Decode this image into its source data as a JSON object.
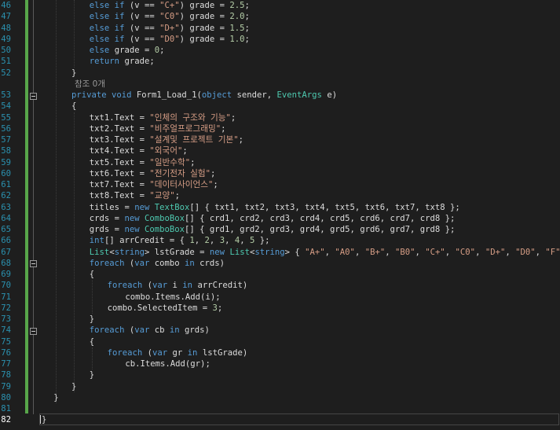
{
  "editor": {
    "code_lens": "참조 0개",
    "lines": [
      {
        "num": "46",
        "indent": 8,
        "tokens": [
          {
            "c": "kw",
            "t": "else if"
          },
          {
            "c": "pl",
            "t": " (v == "
          },
          {
            "c": "st",
            "t": "\"C+\""
          },
          {
            "c": "pl",
            "t": ") grade = "
          },
          {
            "c": "nu",
            "t": "2.5"
          },
          {
            "c": "pl",
            "t": ";"
          }
        ]
      },
      {
        "num": "47",
        "indent": 8,
        "tokens": [
          {
            "c": "kw",
            "t": "else if"
          },
          {
            "c": "pl",
            "t": " (v == "
          },
          {
            "c": "st",
            "t": "\"C0\""
          },
          {
            "c": "pl",
            "t": ") grade = "
          },
          {
            "c": "nu",
            "t": "2.0"
          },
          {
            "c": "pl",
            "t": ";"
          }
        ]
      },
      {
        "num": "48",
        "indent": 8,
        "tokens": [
          {
            "c": "kw",
            "t": "else if"
          },
          {
            "c": "pl",
            "t": " (v == "
          },
          {
            "c": "st",
            "t": "\"D+\""
          },
          {
            "c": "pl",
            "t": ") grade = "
          },
          {
            "c": "nu",
            "t": "1.5"
          },
          {
            "c": "pl",
            "t": ";"
          }
        ]
      },
      {
        "num": "49",
        "indent": 8,
        "tokens": [
          {
            "c": "kw",
            "t": "else if"
          },
          {
            "c": "pl",
            "t": " (v == "
          },
          {
            "c": "st",
            "t": "\"D0\""
          },
          {
            "c": "pl",
            "t": ") grade = "
          },
          {
            "c": "nu",
            "t": "1.0"
          },
          {
            "c": "pl",
            "t": ";"
          }
        ]
      },
      {
        "num": "50",
        "indent": 8,
        "tokens": [
          {
            "c": "kw",
            "t": "else"
          },
          {
            "c": "pl",
            "t": " grade = "
          },
          {
            "c": "nu",
            "t": "0"
          },
          {
            "c": "pl",
            "t": ";"
          }
        ]
      },
      {
        "num": "51",
        "indent": 8,
        "tokens": [
          {
            "c": "kw",
            "t": "return"
          },
          {
            "c": "pl",
            "t": " grade;"
          }
        ]
      },
      {
        "num": "52",
        "indent": 5,
        "tokens": [
          {
            "c": "pl",
            "t": "}"
          }
        ]
      },
      {
        "num": "53",
        "indent": 5,
        "fold": true,
        "tokens": [
          {
            "c": "kw",
            "t": "private void"
          },
          {
            "c": "pl",
            "t": " Form1_Load_1("
          },
          {
            "c": "kw",
            "t": "object"
          },
          {
            "c": "pl",
            "t": " sender, "
          },
          {
            "c": "ty",
            "t": "EventArgs"
          },
          {
            "c": "pl",
            "t": " e)"
          }
        ]
      },
      {
        "num": "54",
        "indent": 5,
        "tokens": [
          {
            "c": "pl",
            "t": "{"
          }
        ]
      },
      {
        "num": "55",
        "indent": 8,
        "tokens": [
          {
            "c": "pl",
            "t": "txt1.Text = "
          },
          {
            "c": "st",
            "t": "\"인체의 구조와 기능\""
          },
          {
            "c": "pl",
            "t": ";"
          }
        ]
      },
      {
        "num": "56",
        "indent": 8,
        "tokens": [
          {
            "c": "pl",
            "t": "txt2.Text = "
          },
          {
            "c": "st",
            "t": "\"비주얼프로그래밍\""
          },
          {
            "c": "pl",
            "t": ";"
          }
        ]
      },
      {
        "num": "57",
        "indent": 8,
        "tokens": [
          {
            "c": "pl",
            "t": "txt3.Text = "
          },
          {
            "c": "st",
            "t": "\"설계및 프로젝트 기본\""
          },
          {
            "c": "pl",
            "t": ";"
          }
        ]
      },
      {
        "num": "58",
        "indent": 8,
        "tokens": [
          {
            "c": "pl",
            "t": "txt4.Text = "
          },
          {
            "c": "st",
            "t": "\"외국어\""
          },
          {
            "c": "pl",
            "t": ";"
          }
        ]
      },
      {
        "num": "59",
        "indent": 8,
        "tokens": [
          {
            "c": "pl",
            "t": "txt5.Text = "
          },
          {
            "c": "st",
            "t": "\"일반수학\""
          },
          {
            "c": "pl",
            "t": ";"
          }
        ]
      },
      {
        "num": "60",
        "indent": 8,
        "tokens": [
          {
            "c": "pl",
            "t": "txt6.Text = "
          },
          {
            "c": "st",
            "t": "\"전기전자 실험\""
          },
          {
            "c": "pl",
            "t": ";"
          }
        ]
      },
      {
        "num": "61",
        "indent": 8,
        "tokens": [
          {
            "c": "pl",
            "t": "txt7.Text = "
          },
          {
            "c": "st",
            "t": "\"데이터사이언스\""
          },
          {
            "c": "pl",
            "t": ";"
          }
        ]
      },
      {
        "num": "62",
        "indent": 8,
        "tokens": [
          {
            "c": "pl",
            "t": "txt8.Text = "
          },
          {
            "c": "st",
            "t": "\"교양\""
          },
          {
            "c": "pl",
            "t": ";"
          }
        ]
      },
      {
        "num": "63",
        "indent": 8,
        "tokens": [
          {
            "c": "pl",
            "t": "titles = "
          },
          {
            "c": "kw",
            "t": "new"
          },
          {
            "c": "pl",
            "t": " "
          },
          {
            "c": "ty",
            "t": "TextBox"
          },
          {
            "c": "pl",
            "t": "[] { txt1, txt2, txt3, txt4, txt5, txt6, txt7, txt8 };"
          }
        ]
      },
      {
        "num": "64",
        "indent": 8,
        "tokens": [
          {
            "c": "pl",
            "t": "crds = "
          },
          {
            "c": "kw",
            "t": "new"
          },
          {
            "c": "pl",
            "t": " "
          },
          {
            "c": "ty",
            "t": "ComboBox"
          },
          {
            "c": "pl",
            "t": "[] { crd1, crd2, crd3, crd4, crd5, crd6, crd7, crd8 };"
          }
        ]
      },
      {
        "num": "65",
        "indent": 8,
        "tokens": [
          {
            "c": "pl",
            "t": "grds = "
          },
          {
            "c": "kw",
            "t": "new"
          },
          {
            "c": "pl",
            "t": " "
          },
          {
            "c": "ty",
            "t": "ComboBox"
          },
          {
            "c": "pl",
            "t": "[] { grd1, grd2, grd3, grd4, grd5, grd6, grd7, grd8 };"
          }
        ]
      },
      {
        "num": "66",
        "indent": 8,
        "tokens": [
          {
            "c": "kw",
            "t": "int"
          },
          {
            "c": "pl",
            "t": "[] arrCredit = { "
          },
          {
            "c": "nu",
            "t": "1"
          },
          {
            "c": "pl",
            "t": ", "
          },
          {
            "c": "nu",
            "t": "2"
          },
          {
            "c": "pl",
            "t": ", "
          },
          {
            "c": "nu",
            "t": "3"
          },
          {
            "c": "pl",
            "t": ", "
          },
          {
            "c": "nu",
            "t": "4"
          },
          {
            "c": "pl",
            "t": ", "
          },
          {
            "c": "nu",
            "t": "5"
          },
          {
            "c": "pl",
            "t": " };"
          }
        ]
      },
      {
        "num": "67",
        "indent": 8,
        "tokens": [
          {
            "c": "ty",
            "t": "List"
          },
          {
            "c": "pl",
            "t": "<"
          },
          {
            "c": "kw",
            "t": "string"
          },
          {
            "c": "pl",
            "t": "> lstGrade = "
          },
          {
            "c": "kw",
            "t": "new"
          },
          {
            "c": "pl",
            "t": " "
          },
          {
            "c": "ty",
            "t": "List"
          },
          {
            "c": "pl",
            "t": "<"
          },
          {
            "c": "kw",
            "t": "string"
          },
          {
            "c": "pl",
            "t": "> { "
          },
          {
            "c": "st",
            "t": "\"A+\""
          },
          {
            "c": "pl",
            "t": ", "
          },
          {
            "c": "st",
            "t": "\"A0\""
          },
          {
            "c": "pl",
            "t": ", "
          },
          {
            "c": "st",
            "t": "\"B+\""
          },
          {
            "c": "pl",
            "t": ", "
          },
          {
            "c": "st",
            "t": "\"B0\""
          },
          {
            "c": "pl",
            "t": ", "
          },
          {
            "c": "st",
            "t": "\"C+\""
          },
          {
            "c": "pl",
            "t": ", "
          },
          {
            "c": "st",
            "t": "\"C0\""
          },
          {
            "c": "pl",
            "t": ", "
          },
          {
            "c": "st",
            "t": "\"D+\""
          },
          {
            "c": "pl",
            "t": ", "
          },
          {
            "c": "st",
            "t": "\"D0\""
          },
          {
            "c": "pl",
            "t": ", "
          },
          {
            "c": "st",
            "t": "\"F\""
          },
          {
            "c": "pl",
            "t": " };"
          }
        ]
      },
      {
        "num": "68",
        "indent": 8,
        "fold": true,
        "tokens": [
          {
            "c": "kw",
            "t": "foreach"
          },
          {
            "c": "pl",
            "t": " ("
          },
          {
            "c": "kw",
            "t": "var"
          },
          {
            "c": "pl",
            "t": " combo "
          },
          {
            "c": "kw",
            "t": "in"
          },
          {
            "c": "pl",
            "t": " crds)"
          }
        ]
      },
      {
        "num": "69",
        "indent": 8,
        "tokens": [
          {
            "c": "pl",
            "t": "{"
          }
        ]
      },
      {
        "num": "70",
        "indent": 11,
        "tokens": [
          {
            "c": "kw",
            "t": "foreach"
          },
          {
            "c": "pl",
            "t": " ("
          },
          {
            "c": "kw",
            "t": "var"
          },
          {
            "c": "pl",
            "t": " i "
          },
          {
            "c": "kw",
            "t": "in"
          },
          {
            "c": "pl",
            "t": " arrCredit)"
          }
        ]
      },
      {
        "num": "71",
        "indent": 14,
        "tokens": [
          {
            "c": "pl",
            "t": "combo.Items.Add(i);"
          }
        ]
      },
      {
        "num": "72",
        "indent": 11,
        "tokens": [
          {
            "c": "pl",
            "t": "combo.SelectedItem = "
          },
          {
            "c": "nu",
            "t": "3"
          },
          {
            "c": "pl",
            "t": ";"
          }
        ]
      },
      {
        "num": "73",
        "indent": 8,
        "tokens": [
          {
            "c": "pl",
            "t": "}"
          }
        ]
      },
      {
        "num": "74",
        "indent": 8,
        "fold": true,
        "tokens": [
          {
            "c": "kw",
            "t": "foreach"
          },
          {
            "c": "pl",
            "t": " ("
          },
          {
            "c": "kw",
            "t": "var"
          },
          {
            "c": "pl",
            "t": " cb "
          },
          {
            "c": "kw",
            "t": "in"
          },
          {
            "c": "pl",
            "t": " grds)"
          }
        ]
      },
      {
        "num": "75",
        "indent": 8,
        "tokens": [
          {
            "c": "pl",
            "t": "{"
          }
        ]
      },
      {
        "num": "76",
        "indent": 11,
        "tokens": [
          {
            "c": "kw",
            "t": "foreach"
          },
          {
            "c": "pl",
            "t": " ("
          },
          {
            "c": "kw",
            "t": "var"
          },
          {
            "c": "pl",
            "t": " gr "
          },
          {
            "c": "kw",
            "t": "in"
          },
          {
            "c": "pl",
            "t": " lstGrade)"
          }
        ]
      },
      {
        "num": "77",
        "indent": 14,
        "tokens": [
          {
            "c": "pl",
            "t": "cb.Items.Add(gr);"
          }
        ]
      },
      {
        "num": "78",
        "indent": 8,
        "tokens": [
          {
            "c": "pl",
            "t": "}"
          }
        ]
      },
      {
        "num": "79",
        "indent": 5,
        "tokens": [
          {
            "c": "pl",
            "t": "}"
          }
        ]
      },
      {
        "num": "80",
        "indent": 2,
        "tokens": [
          {
            "c": "pl",
            "t": "}"
          }
        ]
      },
      {
        "num": "81",
        "indent": 0,
        "tokens": []
      },
      {
        "num": "82",
        "indent": 0,
        "current": true,
        "tokens": [
          {
            "c": "pl",
            "t": "}"
          }
        ]
      }
    ]
  },
  "colors": {
    "background": "#1e1e1e",
    "keyword": "#569cd6",
    "type": "#4ec9b0",
    "string": "#d69d85",
    "number": "#b5cea8",
    "line_number": "#2b91af",
    "change_bar": "#57a64a"
  }
}
